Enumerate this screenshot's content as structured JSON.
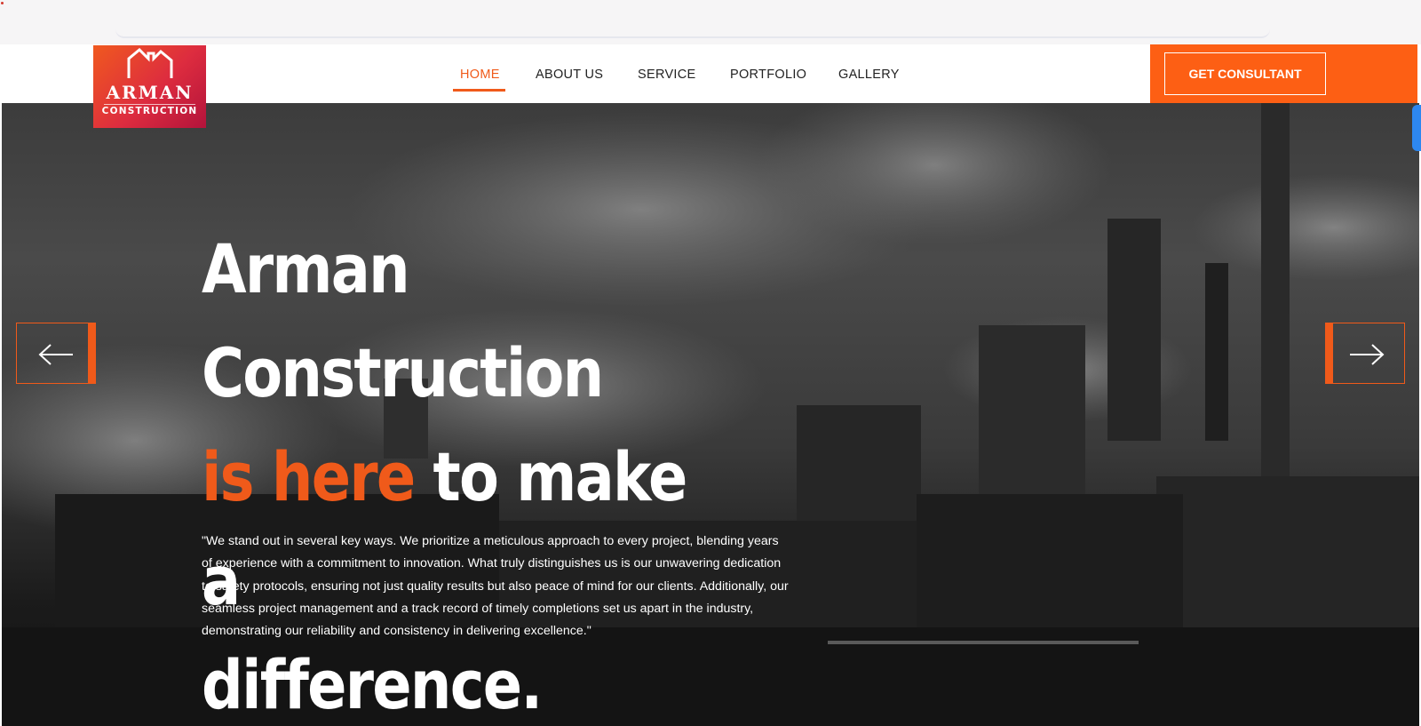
{
  "brand": {
    "name": "ARMAN",
    "tagline": "CONSTRUCTION",
    "accent_color": "#f05a1a",
    "logo_gradient": [
      "#f0591f",
      "#b3133b"
    ]
  },
  "nav": {
    "items": [
      {
        "label": "HOME",
        "active": true
      },
      {
        "label": "ABOUT US",
        "active": false
      },
      {
        "label": "SERVICE",
        "active": false
      },
      {
        "label": "PORTFOLIO",
        "active": false
      },
      {
        "label": "GALLERY",
        "active": false
      }
    ]
  },
  "cta": {
    "label": "GET CONSULTANT",
    "background": "#fd5f14"
  },
  "hero": {
    "title_line1": "Arman Construction",
    "title_accent": "is here",
    "title_rest": " to make a",
    "title_line3": "difference.",
    "description": "\"We stand out in several key ways. We prioritize a meticulous approach to every project, blending years of experience with a commitment to innovation. What truly distinguishes us is our unwavering dedication to safety protocols, ensuring not just quality results but also peace of mind for our clients. Additionally, our seamless project management and a track record of timely completions set us apart in the industry, demonstrating our reliability and consistency in delivering excellence.\"",
    "background_image": "industrial-factory-smokestacks-grayscale",
    "prev_icon": "arrow-left-icon",
    "next_icon": "arrow-right-icon"
  }
}
